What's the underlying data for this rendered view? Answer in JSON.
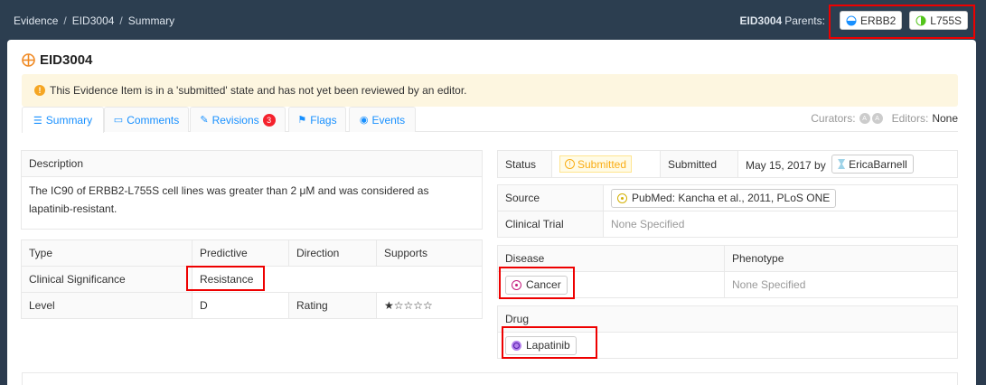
{
  "breadcrumb": [
    "Evidence",
    "EID3004",
    "Summary"
  ],
  "parents": {
    "id": "EID3004",
    "label": "Parents:",
    "items": [
      {
        "label": "ERBB2",
        "icon": "gene-icon"
      },
      {
        "label": "L755S",
        "icon": "variant-icon"
      }
    ]
  },
  "title": "EID3004",
  "alert": "This Evidence Item is in a 'submitted' state and has not yet been reviewed by an editor.",
  "tabs": [
    {
      "label": "Summary",
      "icon": "list-icon"
    },
    {
      "label": "Comments",
      "icon": "comment-icon"
    },
    {
      "label": "Revisions",
      "icon": "edit-icon",
      "badge": "3"
    },
    {
      "label": "Flags",
      "icon": "flag-icon"
    },
    {
      "label": "Events",
      "icon": "events-icon"
    }
  ],
  "curators": {
    "label": "Curators:",
    "avatars": [
      "A",
      "A"
    ],
    "editors_label": "Editors:",
    "editors_value": "None"
  },
  "description": {
    "header": "Description",
    "text": "The IC90 of ERBB2-L755S cell lines was greater than 2 μM and was considered as lapatinib-resistant."
  },
  "attributes": {
    "type_label": "Type",
    "type_value": "Predictive",
    "direction_label": "Direction",
    "direction_value": "Supports",
    "significance_label": "Clinical Significance",
    "significance_value": "Resistance",
    "level_label": "Level",
    "level_value": "D",
    "rating_label": "Rating",
    "rating_value": "★☆☆☆☆",
    "rating_stars": 1
  },
  "status": {
    "label": "Status",
    "value": "Submitted",
    "submitted_label": "Submitted",
    "submitted_date": "May 15, 2017 by",
    "user": "EricaBarnell"
  },
  "source": {
    "label": "Source",
    "value": "PubMed: Kancha et al., 2011, PLoS ONE",
    "trial_label": "Clinical Trial",
    "trial_value": "None Specified"
  },
  "disease": {
    "label": "Disease",
    "value": "Cancer",
    "phenotype_label": "Phenotype",
    "phenotype_value": "None Specified"
  },
  "drug": {
    "label": "Drug",
    "value": "Lapatinib"
  },
  "colors": {
    "topbar": "#2c3e50",
    "link": "#1890ff",
    "alert_bg": "#fdf6e0",
    "highlight": "#e00000"
  }
}
